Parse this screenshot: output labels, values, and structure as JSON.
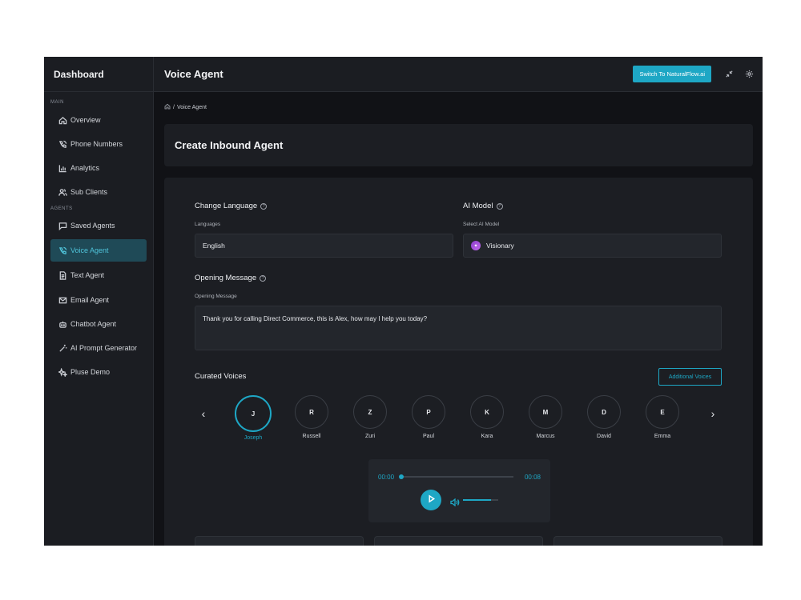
{
  "sidebar": {
    "brand": "Dashboard",
    "main_label": "MAIN",
    "agents_label": "AGENTS",
    "items": [
      {
        "label": "Overview",
        "icon": "home-icon"
      },
      {
        "label": "Phone Numbers",
        "icon": "phone-icon"
      },
      {
        "label": "Analytics",
        "icon": "bar-chart-icon"
      },
      {
        "label": "Sub Clients",
        "icon": "users-icon"
      },
      {
        "label": "Saved Agents",
        "icon": "message-square-icon"
      },
      {
        "label": "Voice Agent",
        "icon": "phone-call-icon",
        "active": true
      },
      {
        "label": "Text Agent",
        "icon": "file-text-icon"
      },
      {
        "label": "Email Agent",
        "icon": "mail-icon"
      },
      {
        "label": "Chatbot Agent",
        "icon": "bot-icon"
      },
      {
        "label": "AI Prompt Generator",
        "icon": "magic-wand-icon"
      },
      {
        "label": "Pluse Demo",
        "icon": "sparkles-icon"
      }
    ]
  },
  "header": {
    "title": "Voice Agent",
    "switch_button": "Switch To NaturalFlow.ai",
    "icons": [
      "collapse-icon",
      "settings-icon"
    ]
  },
  "breadcrumb": {
    "current": "Voice Agent",
    "separator": "/"
  },
  "page": {
    "title": "Create Inbound Agent"
  },
  "form": {
    "language": {
      "title": "Change Language",
      "label": "Languages",
      "value": "English"
    },
    "ai_model": {
      "title": "AI Model",
      "label": "Select AI Model",
      "value": "Visionary"
    },
    "opening": {
      "title": "Opening Message",
      "label": "Opening Message",
      "value": "Thank you for calling Direct Commerce, this is Alex, how may I help you today?"
    },
    "voices_title": "Curated Voices",
    "additional_voices": "Additional Voices",
    "voices": [
      {
        "initial": "J",
        "name": "Joseph",
        "selected": true
      },
      {
        "initial": "R",
        "name": "Russell"
      },
      {
        "initial": "Z",
        "name": "Zuri"
      },
      {
        "initial": "P",
        "name": "Paul"
      },
      {
        "initial": "K",
        "name": "Kara"
      },
      {
        "initial": "M",
        "name": "Marcus"
      },
      {
        "initial": "D",
        "name": "David"
      },
      {
        "initial": "E",
        "name": "Emma"
      }
    ],
    "prev_arrow": "‹",
    "next_arrow": "›"
  },
  "player": {
    "current_time": "00:00",
    "duration": "00:08",
    "progress": 0,
    "volume": 0.8
  },
  "colors": {
    "accent": "#1ea7c5",
    "sidebar_bg": "#1b1d22",
    "card_bg": "#1c1e23",
    "active_nav_bg": "#1f4a57"
  }
}
